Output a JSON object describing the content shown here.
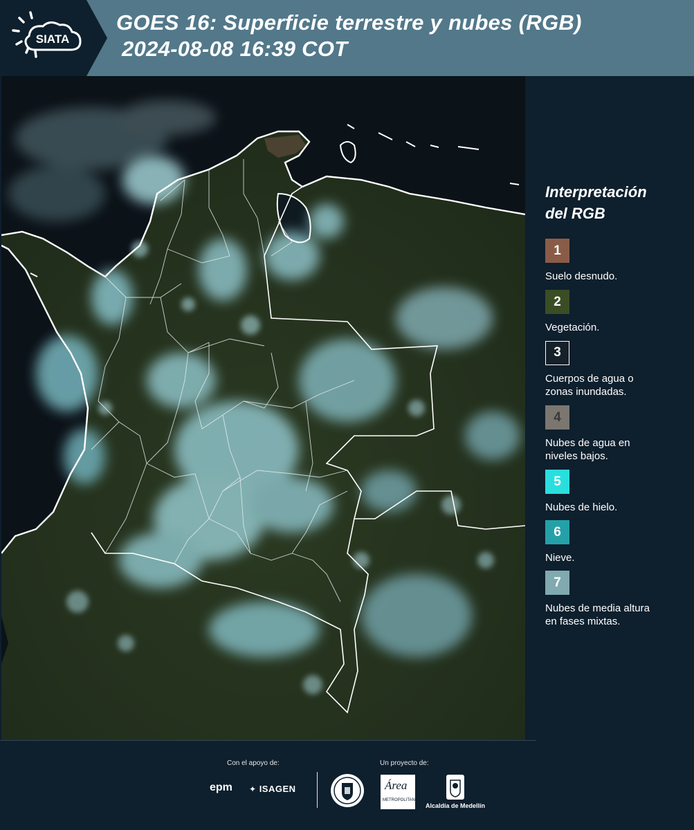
{
  "header": {
    "logo_text": "SIATA",
    "title": "GOES 16: Superficie terrestre y nubes (RGB)",
    "subtitle": "2024-08-08 16:39 COT",
    "background_color": "#52788a"
  },
  "legend": {
    "title_line1": "Interpretación",
    "title_line2": "del RGB",
    "items": [
      {
        "number": "1",
        "label_line1": "Suelo desnudo.",
        "label_line2": "",
        "color": "#8a5c48"
      },
      {
        "number": "2",
        "label_line1": "Vegetación.",
        "label_line2": "",
        "color": "#3b4d25"
      },
      {
        "number": "3",
        "label_line1": "Cuerpos de agua o",
        "label_line2": "zonas inundadas.",
        "color": "#16202a"
      },
      {
        "number": "4",
        "label_line1": "Nubes de agua en",
        "label_line2": "niveles bajos.",
        "color": "#7b7670"
      },
      {
        "number": "5",
        "label_line1": "Nubes de hielo.",
        "label_line2": "",
        "color": "#2bdede"
      },
      {
        "number": "6",
        "label_line1": "Nieve.",
        "label_line2": "",
        "color": "#24a1a8"
      },
      {
        "number": "7",
        "label_line1": "Nubes de media altura",
        "label_line2": "en fases mixtas.",
        "color": "#80aaaf"
      }
    ]
  },
  "footer": {
    "support_label": "Con el apoyo de:",
    "project_label": "Un proyecto de:",
    "epm_logo_text": "epm",
    "isagen_logo_text": "ISAGEN",
    "area_logo_text": "Área",
    "area_logo_subtext": "METROPOLITANA",
    "alcaldia_text": "Alcaldía de Medellín"
  },
  "map": {
    "land_color": "#26331f",
    "ocean_color": "#0b1218",
    "cloud_color": "#8fc3c9",
    "border_color": "#ffffff"
  }
}
